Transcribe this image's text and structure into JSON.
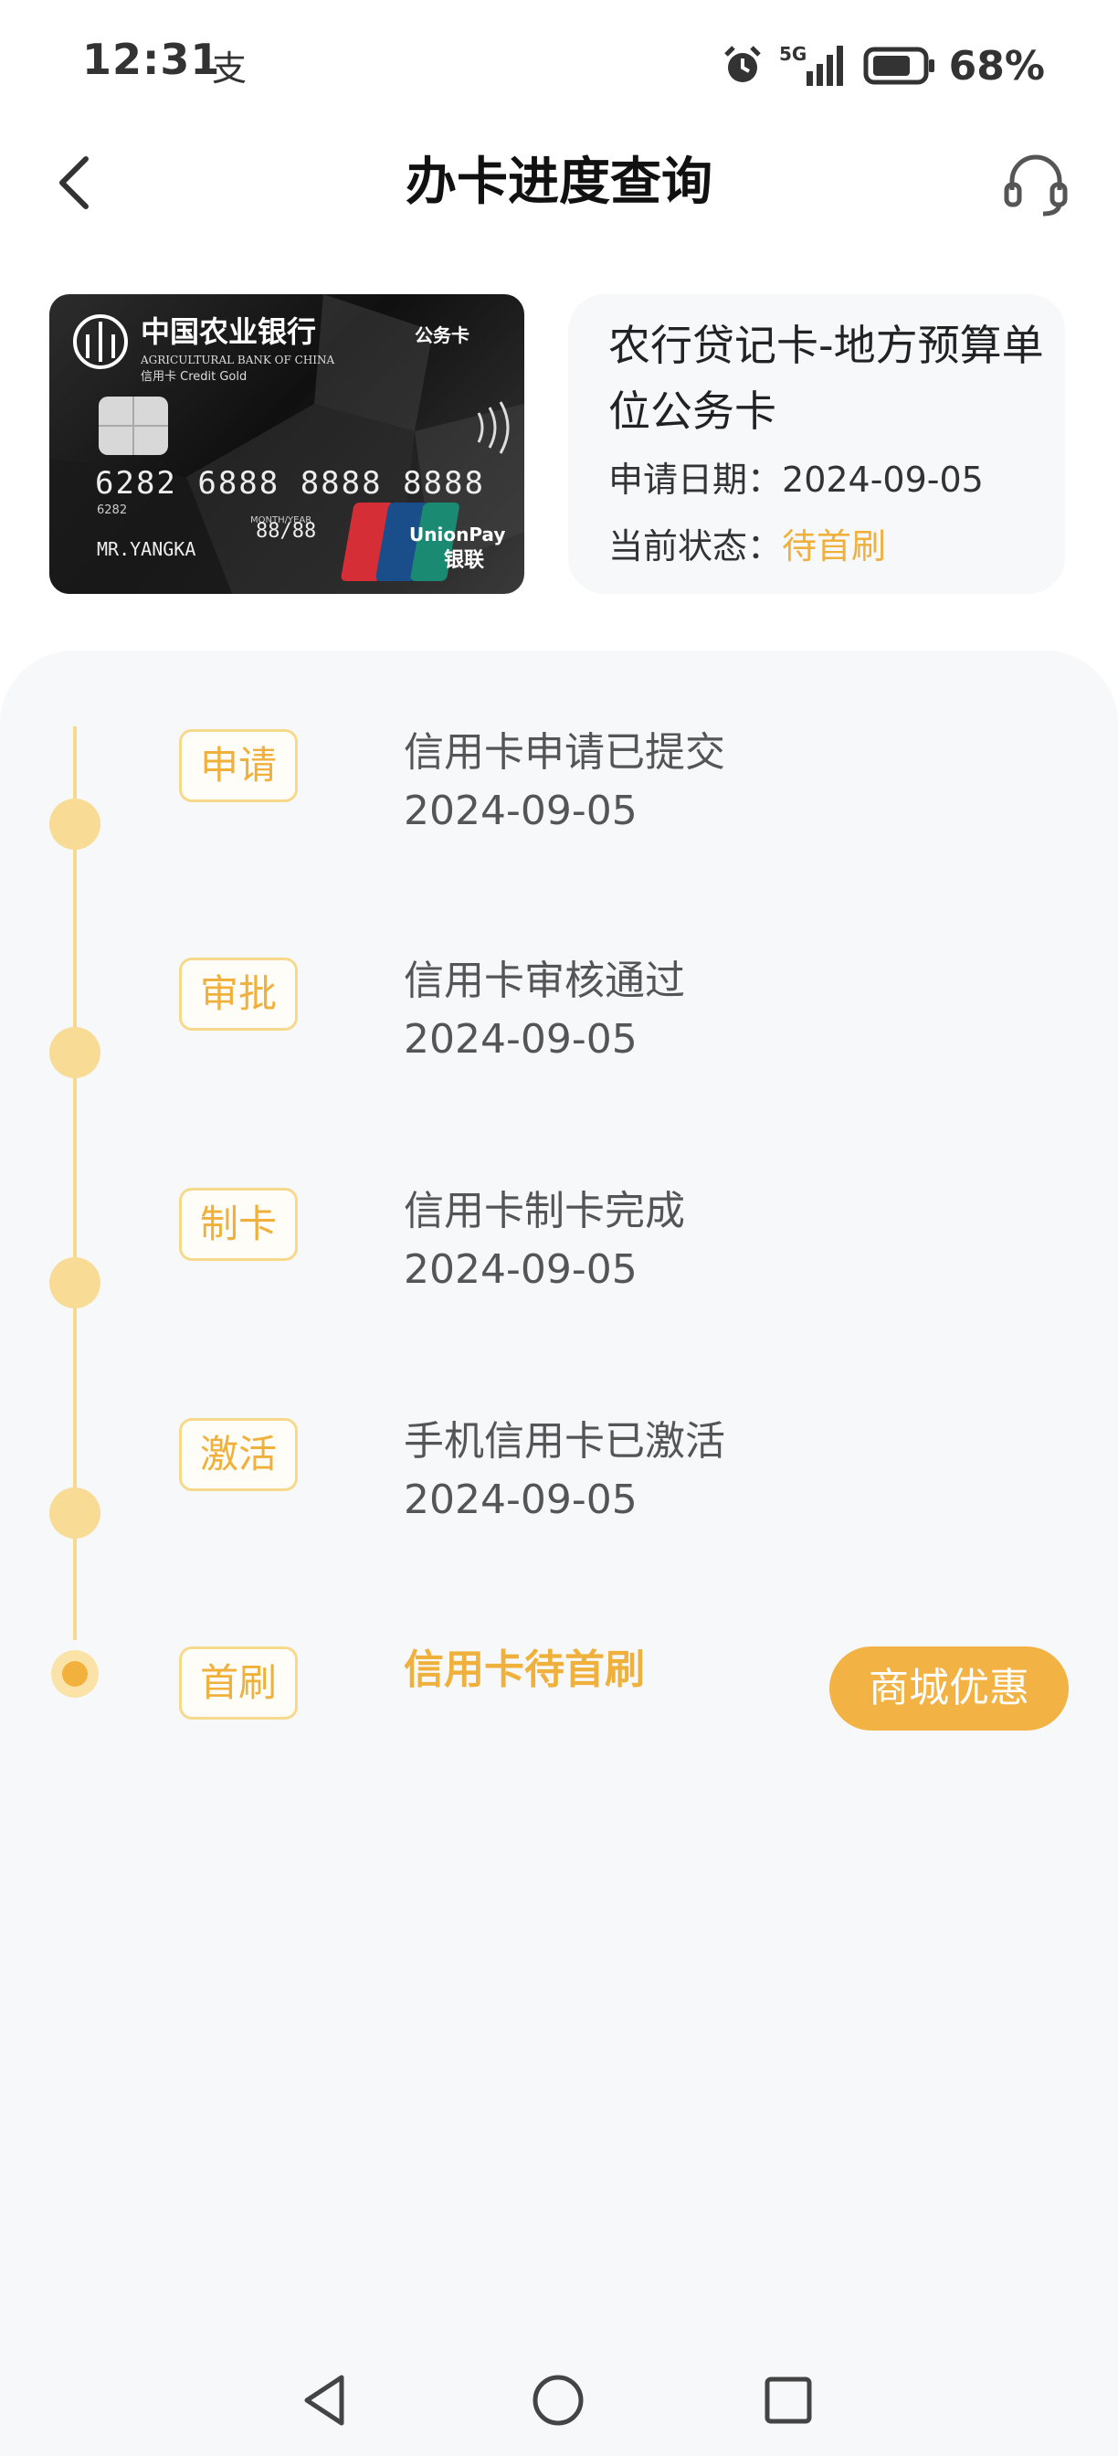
{
  "status_bar": {
    "time": "12:31",
    "alipay_glyph": "支",
    "network": "5G",
    "battery": "68%"
  },
  "header": {
    "title": "办卡进度查询",
    "back_icon": "chevron-left-icon",
    "service_icon": "headset-icon"
  },
  "card": {
    "bank_name_cn": "中国农业银行",
    "bank_name_en": "AGRICULTURAL BANK OF CHINA",
    "card_type_label": "公务卡",
    "card_sub": "信用卡 Credit Gold",
    "card_number": "6282 6888 8888 8888",
    "card_prefix_small": "6282",
    "valid_label": "MONTH/YEAR",
    "valid_thru": "88/88",
    "holder": "MR.YANGKA",
    "unionpay_en": "UnionPay",
    "unionpay_cn": "银联"
  },
  "card_info": {
    "name": "农行贷记卡-地方预算单位公务卡",
    "apply_date_label": "申请日期：",
    "apply_date": "2024-09-05",
    "status_label": "当前状态：",
    "status_value": "待首刷"
  },
  "steps": [
    {
      "tag": "申请",
      "title": "信用卡申请已提交",
      "date": "2024-09-05"
    },
    {
      "tag": "审批",
      "title": "信用卡审核通过",
      "date": "2024-09-05"
    },
    {
      "tag": "制卡",
      "title": "信用卡制卡完成",
      "date": "2024-09-05"
    },
    {
      "tag": "激活",
      "title": "手机信用卡已激活",
      "date": "2024-09-05"
    },
    {
      "tag": "首刷",
      "title": "信用卡待首刷",
      "date": ""
    }
  ],
  "mall_button": "商城优惠",
  "colors": {
    "accent": "#f0b03c",
    "timeline": "#f6d98a",
    "panel_bg": "#f7f8fa"
  },
  "nav": {
    "back": "triangle-back-icon",
    "home": "circle-home-icon",
    "recents": "square-recents-icon"
  }
}
